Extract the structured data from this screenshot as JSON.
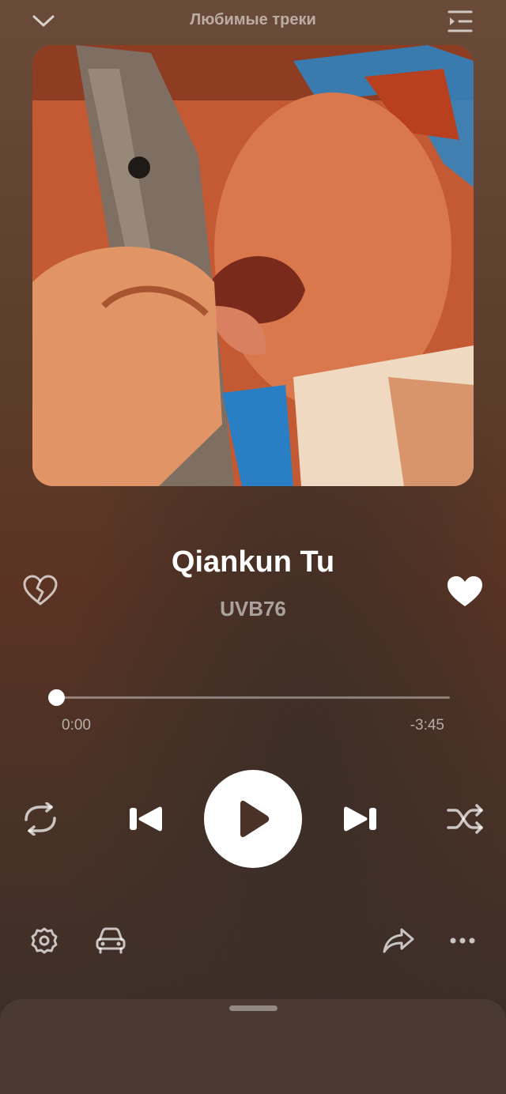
{
  "header": {
    "title": "Любимые треки"
  },
  "track": {
    "title": "Qiankun Tu",
    "artist": "UVB76"
  },
  "progress": {
    "elapsed": "0:00",
    "remaining": "-3:45",
    "fraction": 0.0
  },
  "colors": {
    "accent": "#ffffff",
    "background": "#5c3d2b",
    "muted_text": "rgba(255,255,255,0.55)"
  },
  "icons": {
    "collapse": "chevron-down-icon",
    "queue": "queue-list-icon",
    "dislike": "broken-heart-icon",
    "like": "heart-icon",
    "repeat": "repeat-icon",
    "previous": "skip-previous-icon",
    "play": "play-icon",
    "next": "skip-next-icon",
    "shuffle": "shuffle-icon",
    "settings": "gear-icon",
    "car_mode": "car-icon",
    "share": "share-arrow-icon",
    "more": "more-dots-icon"
  }
}
